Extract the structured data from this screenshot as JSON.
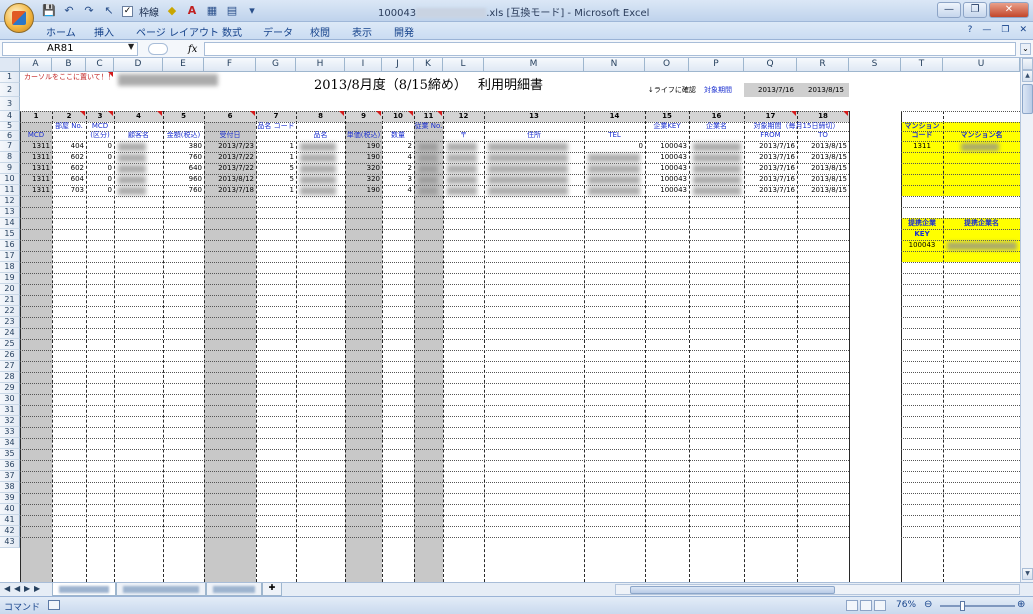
{
  "window": {
    "title_prefix": "100043",
    "title_suffix": ".xls [互換モード] - Microsoft Excel",
    "qat_checkbox_label": "枠線",
    "buttons": {
      "minimize": "—",
      "restore": "❐",
      "close": "✕"
    }
  },
  "ribbon": {
    "tabs": [
      "ホーム",
      "挿入",
      "ページ レイアウト",
      "数式",
      "データ",
      "校閲",
      "表示",
      "開発"
    ],
    "help": "?",
    "ctrl_min": "—",
    "ctrl_restore": "❐",
    "ctrl_close": "✕"
  },
  "formula_bar": {
    "name_box": "AR81",
    "fx": "fx",
    "value": ""
  },
  "columns": [
    "A",
    "B",
    "C",
    "D",
    "E",
    "F",
    "G",
    "H",
    "I",
    "J",
    "K",
    "L",
    "M",
    "N",
    "O",
    "P",
    "Q",
    "R",
    "S",
    "T",
    "U"
  ],
  "rows": [
    "1",
    "2",
    "3",
    "4",
    "5",
    "6",
    "7",
    "8",
    "9",
    "10",
    "11",
    "12",
    "13",
    "14",
    "15",
    "16",
    "17",
    "18",
    "19",
    "20",
    "21",
    "22",
    "23",
    "24",
    "25",
    "26",
    "27",
    "28",
    "29",
    "30",
    "31",
    "32",
    "33",
    "34",
    "35",
    "36",
    "37",
    "38",
    "39",
    "40",
    "41",
    "42",
    "43"
  ],
  "sheet": {
    "cursor_note": "カーソルをここに置いて！！",
    "title": "2013/8月度（8/15締め）",
    "subtitle": "利用明細書",
    "confirm_label": "↓ライフに確認",
    "period_label": "対象期間",
    "period_from": "2013/7/16",
    "period_to": "2013/8/15",
    "col_numbers": [
      "1",
      "2",
      "3",
      "4",
      "5",
      "6",
      "7",
      "8",
      "9",
      "10",
      "11",
      "12",
      "13",
      "14",
      "15",
      "16",
      "17",
      "18"
    ],
    "headers": {
      "mcd": "MCD",
      "room": "部屋 No.",
      "mcd2": "MCD (区分)",
      "customer": "顧客名",
      "amount": "金額(税込)",
      "recv_date": "受付日",
      "prod_code": "品名 コード",
      "prod_name": "品名",
      "unit_price": "単価(税込)",
      "qty": "数量",
      "staff": "従業 No.",
      "zip": "〒",
      "address": "住所",
      "tel": "TEL",
      "company_key": "企業KEY",
      "company_name": "企業名",
      "period_header": "対象期間（毎月15日締切）",
      "from": "FROM",
      "to": "TO"
    },
    "rows": [
      {
        "mcd": "1311",
        "room": "404",
        "mcd2": "0",
        "amount": "380",
        "date": "2013/7/23",
        "code": "1",
        "unit": "190",
        "qty": "2",
        "tel": "0",
        "key": "100043",
        "from": "2013/7/16",
        "to": "2013/8/15"
      },
      {
        "mcd": "1311",
        "room": "602",
        "mcd2": "0",
        "amount": "760",
        "date": "2013/7/22",
        "code": "1",
        "unit": "190",
        "qty": "4",
        "tel": "",
        "key": "100043",
        "from": "2013/7/16",
        "to": "2013/8/15"
      },
      {
        "mcd": "1311",
        "room": "602",
        "mcd2": "0",
        "amount": "640",
        "date": "2013/7/22",
        "code": "5",
        "unit": "320",
        "qty": "2",
        "tel": "",
        "key": "100043",
        "from": "2013/7/16",
        "to": "2013/8/15"
      },
      {
        "mcd": "1311",
        "room": "604",
        "mcd2": "0",
        "amount": "960",
        "date": "2013/8/12",
        "code": "5",
        "unit": "320",
        "qty": "3",
        "tel": "",
        "key": "100043",
        "from": "2013/7/16",
        "to": "2013/8/15"
      },
      {
        "mcd": "1311",
        "room": "703",
        "mcd2": "0",
        "amount": "760",
        "date": "2013/7/18",
        "code": "1",
        "unit": "190",
        "qty": "4",
        "tel": "",
        "key": "100043",
        "from": "2013/7/16",
        "to": "2013/8/15"
      }
    ],
    "side1": {
      "h1": "マンション",
      "h1b": "コード",
      "h2": "マンション名",
      "code": "1311"
    },
    "side2": {
      "h1": "提携企業",
      "h1b": "KEY",
      "h2": "提携企業名",
      "key": "100043"
    }
  },
  "status": {
    "mode": "コマンド",
    "zoom": "76%"
  },
  "colors": {
    "yellow": "#ffff00",
    "gray": "#c8c8c8",
    "blue_text": "#1a2fd0"
  }
}
